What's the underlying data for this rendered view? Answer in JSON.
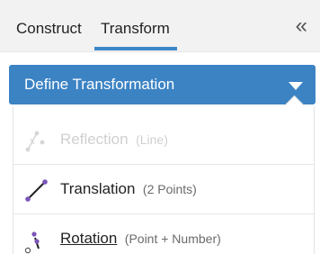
{
  "tabs": [
    {
      "label": "Construct",
      "active": false
    },
    {
      "label": "Transform",
      "active": true
    }
  ],
  "collapse_icon": "double-chevron-left",
  "accent_color": "#3c83c4",
  "dropdown": {
    "label": "Define Transformation",
    "caret_icon": "caret-down"
  },
  "menu": {
    "items": [
      {
        "name": "Reflection",
        "sub": "(Line)",
        "disabled": true,
        "icon": "reflection-icon"
      },
      {
        "name": "Translation",
        "sub": "(2 Points)",
        "disabled": false,
        "icon": "translation-icon"
      },
      {
        "name": "Rotation",
        "sub": "(Point + Number)",
        "disabled": false,
        "icon": "rotation-icon",
        "hovered": true
      }
    ]
  }
}
